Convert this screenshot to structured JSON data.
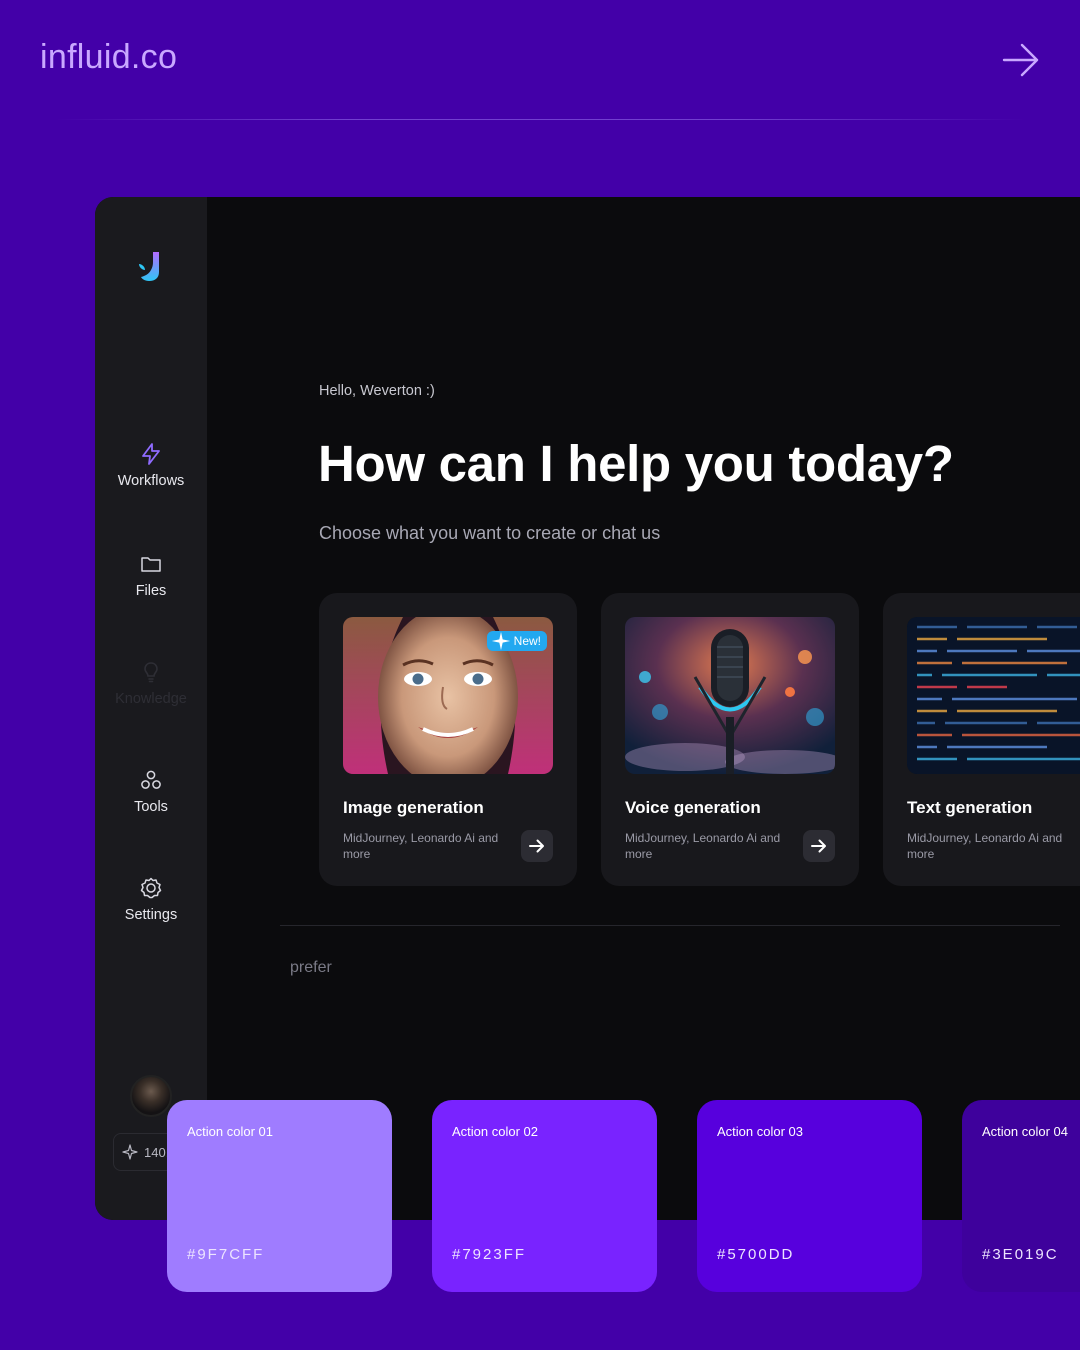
{
  "brand": {
    "name": "influid.co"
  },
  "sidebar": {
    "items": [
      {
        "label": "Workflows"
      },
      {
        "label": "Files"
      },
      {
        "label": "Knowledge"
      },
      {
        "label": "Tools"
      },
      {
        "label": "Settings"
      }
    ],
    "credits": "140."
  },
  "main": {
    "greeting": "Hello, Weverton :)",
    "headline": "How can I help you today?",
    "subtitle": "Choose what you want to create or chat us",
    "cards": [
      {
        "title": "Image generation",
        "description": "MidJourney, Leonardo Ai and more",
        "badge": "New!"
      },
      {
        "title": "Voice generation",
        "description": "MidJourney, Leonardo Ai and more"
      },
      {
        "title": "Text generation",
        "description": "MidJourney, Leonardo Ai and more"
      }
    ],
    "prompt_placeholder_partial": "prefer"
  },
  "swatches": [
    {
      "name": "Action color 01",
      "hex": "#9F7CFF"
    },
    {
      "name": "Action color 02",
      "hex": "#7923FF"
    },
    {
      "name": "Action color 03",
      "hex": "#5700DD"
    },
    {
      "name": "Action color 04",
      "hex": "#3E019C"
    }
  ],
  "colors": {
    "page_background": "#4300A8",
    "app_background": "#0B0B0D",
    "sidebar_background": "#1A1A1E",
    "card_background": "#18181C",
    "accent": "#9F7CFF",
    "badge": "#22A8F0"
  }
}
